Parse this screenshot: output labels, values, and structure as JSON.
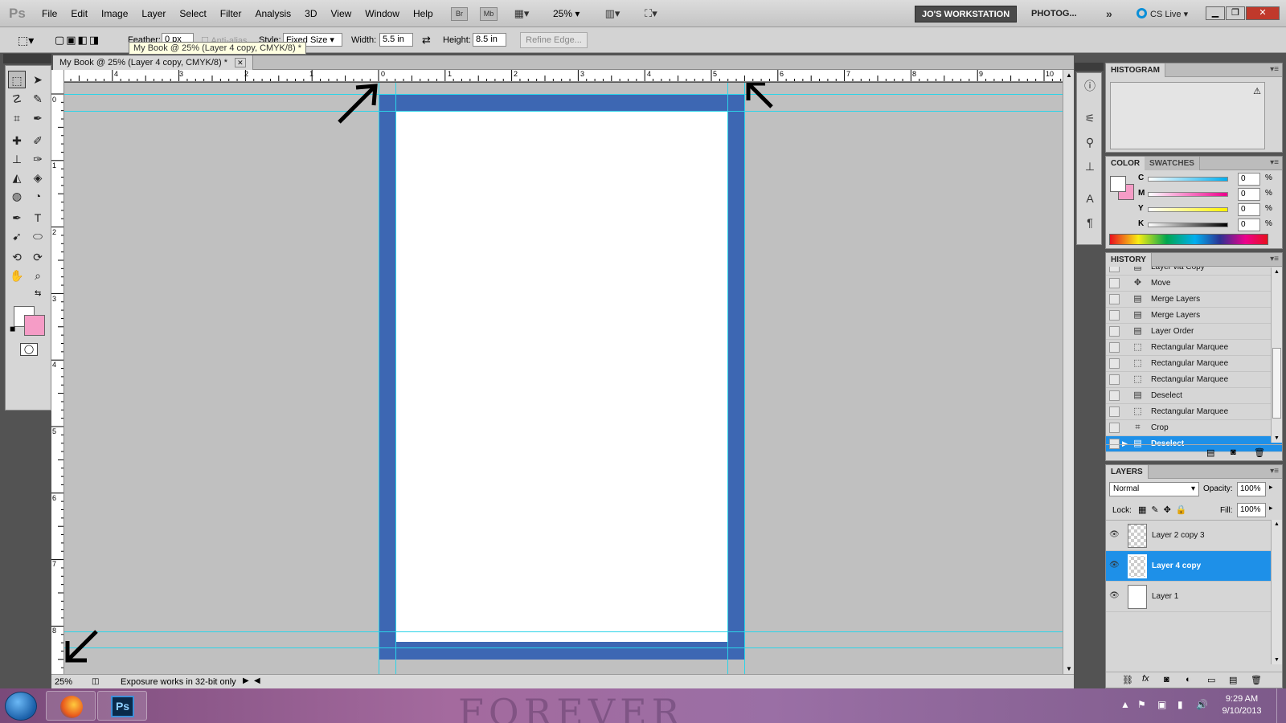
{
  "menubar": {
    "logo": "Ps",
    "items": [
      "File",
      "Edit",
      "Image",
      "Layer",
      "Select",
      "Filter",
      "Analysis",
      "3D",
      "View",
      "Window",
      "Help"
    ],
    "bridge_label": "Br",
    "minibridge_label": "Mb",
    "zoom": "25%",
    "workspace_active": "JO'S WORKSTATION",
    "workspace_other": "PHOTOG...",
    "more": "»",
    "cs_live": "CS Live"
  },
  "options": {
    "feather_label": "Feather:",
    "feather_value": "0 px",
    "antialias_label": "Anti-alias",
    "style_label": "Style:",
    "style_value": "Fixed Size",
    "width_label": "Width:",
    "width_value": "5.5 in",
    "height_label": "Height:",
    "height_value": "8.5 in",
    "refine_edge": "Refine Edge..."
  },
  "document": {
    "tab_title": "My Book @ 25% (Layer 4 copy, CMYK/8) *",
    "tooltip": "My Book @ 25% (Layer 4 copy, CMYK/8) *",
    "ruler_top_ticks": [
      "4",
      "3",
      "2",
      "1",
      "0",
      "1",
      "2",
      "3",
      "4",
      "5",
      "6",
      "7",
      "8",
      "9",
      "10"
    ],
    "ruler_left_ticks": [
      "0",
      "1",
      "2",
      "3",
      "4",
      "5",
      "6",
      "7",
      "8"
    ],
    "status_zoom": "25%",
    "status_message": "Exposure works in 32-bit only"
  },
  "panels": {
    "histogram_title": "HISTOGRAM",
    "color_tab": "COLOR",
    "swatches_tab": "SWATCHES",
    "color_channels": [
      {
        "letter": "C",
        "value": "0",
        "unit": "%"
      },
      {
        "letter": "M",
        "value": "0",
        "unit": "%"
      },
      {
        "letter": "Y",
        "value": "0",
        "unit": "%"
      },
      {
        "letter": "K",
        "value": "0",
        "unit": "%"
      }
    ],
    "history_title": "HISTORY",
    "history_items": [
      {
        "label": "Layer via Copy",
        "icon": "▤"
      },
      {
        "label": "Move",
        "icon": "✥"
      },
      {
        "label": "Merge Layers",
        "icon": "▤"
      },
      {
        "label": "Merge Layers",
        "icon": "▤"
      },
      {
        "label": "Layer Order",
        "icon": "▤"
      },
      {
        "label": "Rectangular Marquee",
        "icon": "⬚"
      },
      {
        "label": "Rectangular Marquee",
        "icon": "⬚"
      },
      {
        "label": "Rectangular Marquee",
        "icon": "⬚"
      },
      {
        "label": "Deselect",
        "icon": "▤"
      },
      {
        "label": "Rectangular Marquee",
        "icon": "⬚"
      },
      {
        "label": "Crop",
        "icon": "⌗"
      },
      {
        "label": "Deselect",
        "icon": "▤"
      }
    ],
    "layers_title": "LAYERS",
    "blend_mode": "Normal",
    "opacity_label": "Opacity:",
    "opacity_value": "100%",
    "lock_label": "Lock:",
    "fill_label": "Fill:",
    "fill_value": "100%",
    "layers": [
      {
        "name": "Layer 2 copy 3"
      },
      {
        "name": "Layer 4 copy"
      },
      {
        "name": "Layer 1"
      }
    ]
  },
  "taskbar": {
    "background_text": "FOREVER",
    "time": "9:29 AM",
    "date": "9/10/2013",
    "ps_app_label": "Ps"
  },
  "colors": {
    "page_border": "#3d67b3",
    "guide": "#2bd4e8",
    "background_swatch": "#f59cc6",
    "selection": "#1e90e8"
  }
}
